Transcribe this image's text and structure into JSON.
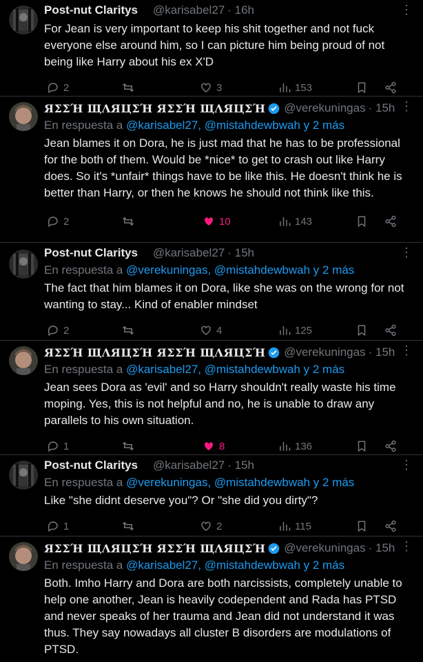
{
  "colors": {
    "background": "#000000",
    "text": "#e7e9ea",
    "muted": "#71767b",
    "link": "#1d9bf0",
    "like": "#f91880",
    "divider": "#2f3336",
    "verified": "#1d9bf0"
  },
  "reply_prefix": "En respuesta a",
  "tweets": [
    {
      "name": "Post-nut Claritys",
      "handle": "@karisabel27",
      "time": "· 16h",
      "reply_to": "",
      "text": "For Jean is very important to keep his shit together and not fuck everyone else around him, so I can picture him being proud of not being like Harry about his ex X'D",
      "replies": "2",
      "retweets": "",
      "likes": "3",
      "views": "153",
      "liked": false
    },
    {
      "name": "ЯΣΣΉ ЩΛЯЦΣΉ ЯΣΣΉ ЩΛЯЦΣΉ",
      "handle": "@verekuningas",
      "time": "· 15h",
      "reply_to": "@karisabel27, @mistahdewbwah y 2 más",
      "text": "Jean blames it on Dora, he is just mad that he has to be professional for the both of them. Would be *nice* to get to crash out like Harry does. So it's *unfair* things have to be like this. He doesn't think he is better than Harry, or then he knows he should not think like this.",
      "replies": "2",
      "retweets": "",
      "likes": "10",
      "views": "143",
      "liked": true
    },
    {
      "name": "Post-nut Claritys",
      "handle": "@karisabel27",
      "time": "· 15h",
      "reply_to": "@verekuningas, @mistahdewbwah y 2 más",
      "text": "The fact that him blames it on Dora, like she was on the wrong for not wanting to stay... Kind of enabler mindset",
      "replies": "2",
      "retweets": "",
      "likes": "4",
      "views": "125",
      "liked": false
    },
    {
      "name": "ЯΣΣΉ ЩΛЯЦΣΉ ЯΣΣΉ ЩΛЯЦΣΉ",
      "handle": "@verekuningas",
      "time": "· 15h",
      "reply_to": "@karisabel27, @mistahdewbwah y 2 más",
      "text": "Jean sees Dora as 'evil' and so Harry shouldn't really waste his time moping. Yes, this is not helpful and no, he is unable to draw any parallels to his own situation.",
      "replies": "1",
      "retweets": "",
      "likes": "8",
      "views": "136",
      "liked": true
    },
    {
      "name": "Post-nut Claritys",
      "handle": "@karisabel27",
      "time": "· 15h",
      "reply_to": "@verekuningas, @mistahdewbwah y 2 más",
      "text": "Like \"she didnt deserve you\"? Or \"she did you dirty\"?",
      "replies": "1",
      "retweets": "",
      "likes": "2",
      "views": "115",
      "liked": false
    },
    {
      "name": "ЯΣΣΉ ЩΛЯЦΣΉ ЯΣΣΉ ЩΛЯЦΣΉ",
      "handle": "@verekuningas",
      "time": "· 15h",
      "reply_to": "@karisabel27, @mistahdewbwah y 2 más",
      "text": "Both. Imho Harry and Dora are both narcissists, completely unable to help one another, Jean is heavily codependent and Rada has PTSD and never speaks of her trauma and Jean did not understand it was thus. They say nowadays all cluster B disorders are modulations of PTSD.",
      "replies": "",
      "retweets": "",
      "likes": "",
      "views": "",
      "liked": false
    }
  ]
}
